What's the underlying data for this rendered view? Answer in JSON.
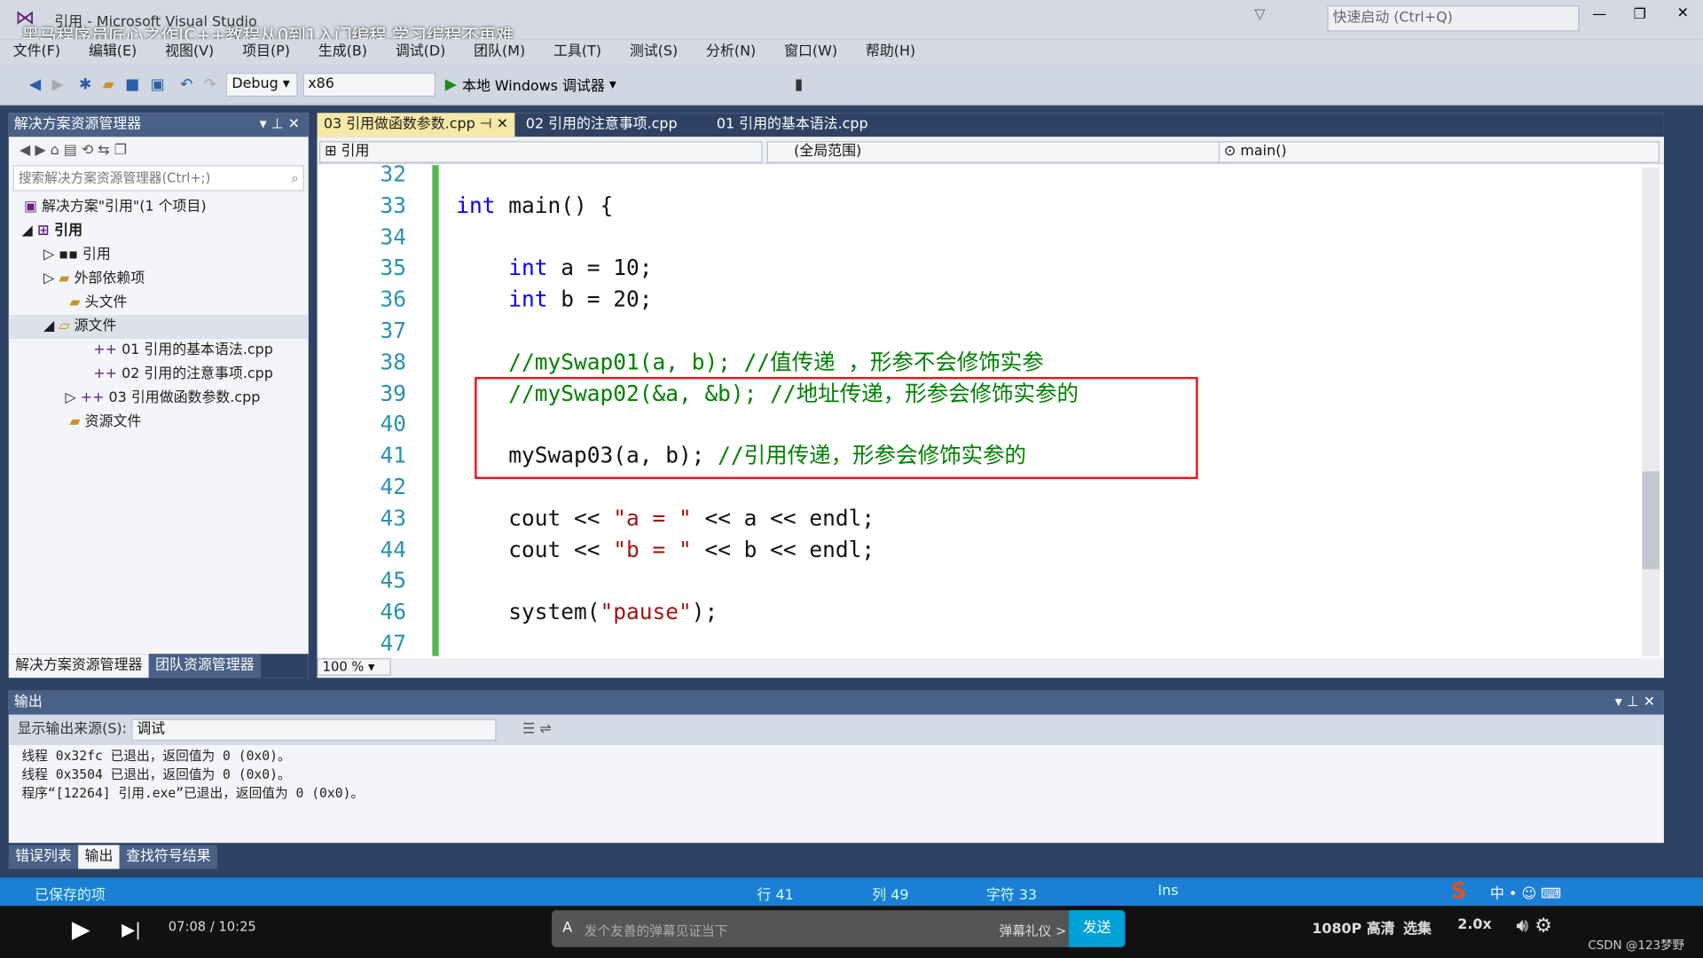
{
  "window": {
    "title": "引用 - Microsoft Visual Studio",
    "overlay_title": "黑马程序员匠心之作|C++教程从0到1入门编程,学习编程不再难",
    "quick_launch": "快速启动 (Ctrl+Q)",
    "watermark": "黑马程序员"
  },
  "menu": [
    "文件(F)",
    "编辑(E)",
    "视图(V)",
    "项目(P)",
    "生成(B)",
    "调试(D)",
    "团队(M)",
    "工具(T)",
    "测试(S)",
    "分析(N)",
    "窗口(W)",
    "帮助(H)"
  ],
  "toolbar": {
    "config": "Debug",
    "platform": "x86",
    "run": "本地 Windows 调试器"
  },
  "solution_explorer": {
    "title": "解决方案资源管理器",
    "search_placeholder": "搜索解决方案资源管理器(Ctrl+;)",
    "items": [
      "解决方案\"引用\"(1 个项目)",
      "引用",
      "引用",
      "外部依赖项",
      "头文件",
      "源文件",
      "01 引用的基本语法.cpp",
      "02 引用的注意事项.cpp",
      "03 引用做函数参数.cpp",
      "资源文件"
    ],
    "bottom_tabs": [
      "解决方案资源管理器",
      "团队资源管理器"
    ]
  },
  "editor": {
    "tabs": [
      "03 引用做函数参数.cpp",
      "02 引用的注意事项.cpp",
      "01 引用的基本语法.cpp"
    ],
    "nav": {
      "project": "引用",
      "scope": "(全局范围)",
      "member": "main()"
    },
    "zoom": "100 %",
    "lines": [
      {
        "n": "32",
        "t": ""
      },
      {
        "n": "33",
        "t": "int main() {"
      },
      {
        "n": "34",
        "t": ""
      },
      {
        "n": "35",
        "t": "    int a = 10;"
      },
      {
        "n": "36",
        "t": "    int b = 20;"
      },
      {
        "n": "37",
        "t": ""
      },
      {
        "n": "38",
        "t": "    //mySwap01(a, b); //值传递 ，形参不会修饰实参"
      },
      {
        "n": "39",
        "t": "    //mySwap02(&a, &b); //地址传递，形参会修饰实参的"
      },
      {
        "n": "40",
        "t": ""
      },
      {
        "n": "41",
        "t": "    mySwap03(a, b); //引用传递，形参会修饰实参的"
      },
      {
        "n": "42",
        "t": ""
      },
      {
        "n": "43",
        "t": "    cout << \"a = \" << a << endl;"
      },
      {
        "n": "44",
        "t": "    cout << \"b = \" << b << endl;"
      },
      {
        "n": "45",
        "t": ""
      },
      {
        "n": "46",
        "t": "    system(\"pause\");"
      },
      {
        "n": "47",
        "t": ""
      }
    ]
  },
  "output": {
    "title": "输出",
    "source_label": "显示输出来源(S):",
    "source": "调试",
    "lines": [
      "线程 0x32fc 已退出，返回值为 0 (0x0)。",
      "线程 0x3504 已退出，返回值为 0 (0x0)。",
      "程序“[12264] 引用.exe”已退出，返回值为 0 (0x0)。"
    ],
    "tabs": [
      "错误列表",
      "输出",
      "查找符号结果"
    ]
  },
  "status": {
    "text": "已保存的项",
    "row": "行 41",
    "col": "列 49",
    "ch": "字符 33",
    "mode": "Ins"
  },
  "player": {
    "time": "07:08 / 10:25",
    "danmaku_placeholder": "发个友善的弹幕见证当下",
    "etiquette": "弹幕礼仪 >",
    "send": "发送",
    "quality": "1080P 高清",
    "episodes": "选集",
    "speed": "2.0x",
    "credit": "CSDN @123梦野"
  }
}
